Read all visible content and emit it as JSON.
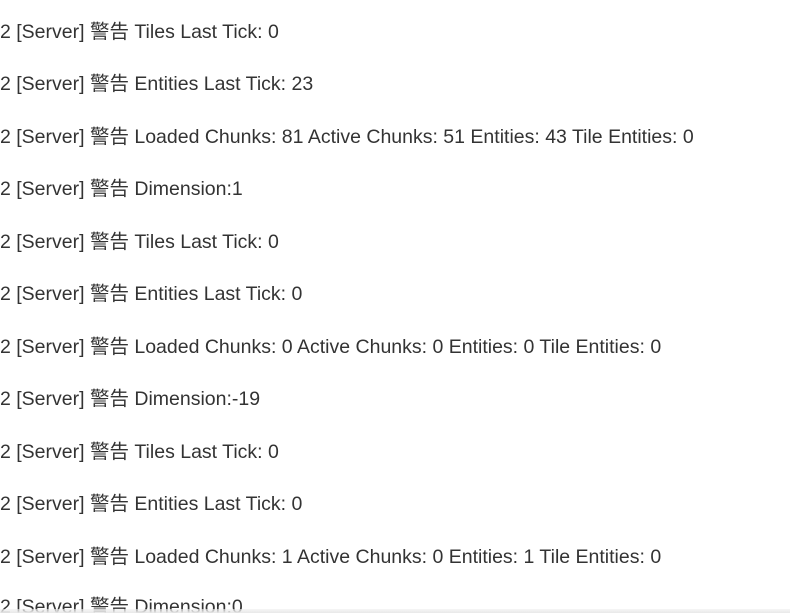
{
  "log": {
    "lines": [
      "2 [Server] 警告 Tiles Last Tick: 0",
      "2 [Server] 警告 Entities Last Tick: 23",
      "2 [Server] 警告 Loaded Chunks: 81 Active Chunks: 51 Entities: 43 Tile Entities: 0",
      "2 [Server] 警告 Dimension:1",
      "2 [Server] 警告 Tiles Last Tick: 0",
      "2 [Server] 警告 Entities Last Tick: 0",
      "2 [Server] 警告 Loaded Chunks: 0 Active Chunks: 0 Entities: 0 Tile Entities: 0",
      "2 [Server] 警告 Dimension:-19",
      "2 [Server] 警告 Tiles Last Tick: 0",
      "2 [Server] 警告 Entities Last Tick: 0",
      "2 [Server] 警告 Loaded Chunks: 1 Active Chunks: 0 Entities: 1 Tile Entities: 0",
      "2 [Server] 警告 Dimension:0"
    ]
  }
}
